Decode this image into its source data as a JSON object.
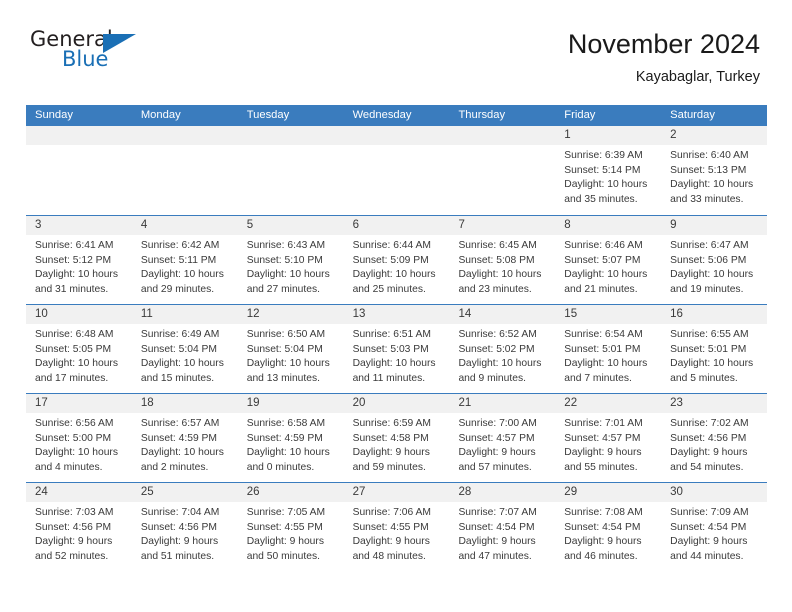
{
  "logo": {
    "word_one": "General",
    "word_two": "Blue",
    "triangle_icon": "blue-triangle-icon",
    "brand_color": "#1a6fb5"
  },
  "header": {
    "title": "November 2024",
    "subtitle": "Kayabaglar, Turkey"
  },
  "calendar": {
    "header_color": "#3a7cbe",
    "day_band_color": "#f1f1f1",
    "weekdays": [
      "Sunday",
      "Monday",
      "Tuesday",
      "Wednesday",
      "Thursday",
      "Friday",
      "Saturday"
    ],
    "weeks": [
      [
        {
          "empty": true
        },
        {
          "empty": true
        },
        {
          "empty": true
        },
        {
          "empty": true
        },
        {
          "empty": true
        },
        {
          "day": "1",
          "sunrise": "Sunrise: 6:39 AM",
          "sunset": "Sunset: 5:14 PM",
          "daylight_1": "Daylight: 10 hours",
          "daylight_2": "and 35 minutes."
        },
        {
          "day": "2",
          "sunrise": "Sunrise: 6:40 AM",
          "sunset": "Sunset: 5:13 PM",
          "daylight_1": "Daylight: 10 hours",
          "daylight_2": "and 33 minutes."
        }
      ],
      [
        {
          "day": "3",
          "sunrise": "Sunrise: 6:41 AM",
          "sunset": "Sunset: 5:12 PM",
          "daylight_1": "Daylight: 10 hours",
          "daylight_2": "and 31 minutes."
        },
        {
          "day": "4",
          "sunrise": "Sunrise: 6:42 AM",
          "sunset": "Sunset: 5:11 PM",
          "daylight_1": "Daylight: 10 hours",
          "daylight_2": "and 29 minutes."
        },
        {
          "day": "5",
          "sunrise": "Sunrise: 6:43 AM",
          "sunset": "Sunset: 5:10 PM",
          "daylight_1": "Daylight: 10 hours",
          "daylight_2": "and 27 minutes."
        },
        {
          "day": "6",
          "sunrise": "Sunrise: 6:44 AM",
          "sunset": "Sunset: 5:09 PM",
          "daylight_1": "Daylight: 10 hours",
          "daylight_2": "and 25 minutes."
        },
        {
          "day": "7",
          "sunrise": "Sunrise: 6:45 AM",
          "sunset": "Sunset: 5:08 PM",
          "daylight_1": "Daylight: 10 hours",
          "daylight_2": "and 23 minutes."
        },
        {
          "day": "8",
          "sunrise": "Sunrise: 6:46 AM",
          "sunset": "Sunset: 5:07 PM",
          "daylight_1": "Daylight: 10 hours",
          "daylight_2": "and 21 minutes."
        },
        {
          "day": "9",
          "sunrise": "Sunrise: 6:47 AM",
          "sunset": "Sunset: 5:06 PM",
          "daylight_1": "Daylight: 10 hours",
          "daylight_2": "and 19 minutes."
        }
      ],
      [
        {
          "day": "10",
          "sunrise": "Sunrise: 6:48 AM",
          "sunset": "Sunset: 5:05 PM",
          "daylight_1": "Daylight: 10 hours",
          "daylight_2": "and 17 minutes."
        },
        {
          "day": "11",
          "sunrise": "Sunrise: 6:49 AM",
          "sunset": "Sunset: 5:04 PM",
          "daylight_1": "Daylight: 10 hours",
          "daylight_2": "and 15 minutes."
        },
        {
          "day": "12",
          "sunrise": "Sunrise: 6:50 AM",
          "sunset": "Sunset: 5:04 PM",
          "daylight_1": "Daylight: 10 hours",
          "daylight_2": "and 13 minutes."
        },
        {
          "day": "13",
          "sunrise": "Sunrise: 6:51 AM",
          "sunset": "Sunset: 5:03 PM",
          "daylight_1": "Daylight: 10 hours",
          "daylight_2": "and 11 minutes."
        },
        {
          "day": "14",
          "sunrise": "Sunrise: 6:52 AM",
          "sunset": "Sunset: 5:02 PM",
          "daylight_1": "Daylight: 10 hours",
          "daylight_2": "and 9 minutes."
        },
        {
          "day": "15",
          "sunrise": "Sunrise: 6:54 AM",
          "sunset": "Sunset: 5:01 PM",
          "daylight_1": "Daylight: 10 hours",
          "daylight_2": "and 7 minutes."
        },
        {
          "day": "16",
          "sunrise": "Sunrise: 6:55 AM",
          "sunset": "Sunset: 5:01 PM",
          "daylight_1": "Daylight: 10 hours",
          "daylight_2": "and 5 minutes."
        }
      ],
      [
        {
          "day": "17",
          "sunrise": "Sunrise: 6:56 AM",
          "sunset": "Sunset: 5:00 PM",
          "daylight_1": "Daylight: 10 hours",
          "daylight_2": "and 4 minutes."
        },
        {
          "day": "18",
          "sunrise": "Sunrise: 6:57 AM",
          "sunset": "Sunset: 4:59 PM",
          "daylight_1": "Daylight: 10 hours",
          "daylight_2": "and 2 minutes."
        },
        {
          "day": "19",
          "sunrise": "Sunrise: 6:58 AM",
          "sunset": "Sunset: 4:59 PM",
          "daylight_1": "Daylight: 10 hours",
          "daylight_2": "and 0 minutes."
        },
        {
          "day": "20",
          "sunrise": "Sunrise: 6:59 AM",
          "sunset": "Sunset: 4:58 PM",
          "daylight_1": "Daylight: 9 hours",
          "daylight_2": "and 59 minutes."
        },
        {
          "day": "21",
          "sunrise": "Sunrise: 7:00 AM",
          "sunset": "Sunset: 4:57 PM",
          "daylight_1": "Daylight: 9 hours",
          "daylight_2": "and 57 minutes."
        },
        {
          "day": "22",
          "sunrise": "Sunrise: 7:01 AM",
          "sunset": "Sunset: 4:57 PM",
          "daylight_1": "Daylight: 9 hours",
          "daylight_2": "and 55 minutes."
        },
        {
          "day": "23",
          "sunrise": "Sunrise: 7:02 AM",
          "sunset": "Sunset: 4:56 PM",
          "daylight_1": "Daylight: 9 hours",
          "daylight_2": "and 54 minutes."
        }
      ],
      [
        {
          "day": "24",
          "sunrise": "Sunrise: 7:03 AM",
          "sunset": "Sunset: 4:56 PM",
          "daylight_1": "Daylight: 9 hours",
          "daylight_2": "and 52 minutes."
        },
        {
          "day": "25",
          "sunrise": "Sunrise: 7:04 AM",
          "sunset": "Sunset: 4:56 PM",
          "daylight_1": "Daylight: 9 hours",
          "daylight_2": "and 51 minutes."
        },
        {
          "day": "26",
          "sunrise": "Sunrise: 7:05 AM",
          "sunset": "Sunset: 4:55 PM",
          "daylight_1": "Daylight: 9 hours",
          "daylight_2": "and 50 minutes."
        },
        {
          "day": "27",
          "sunrise": "Sunrise: 7:06 AM",
          "sunset": "Sunset: 4:55 PM",
          "daylight_1": "Daylight: 9 hours",
          "daylight_2": "and 48 minutes."
        },
        {
          "day": "28",
          "sunrise": "Sunrise: 7:07 AM",
          "sunset": "Sunset: 4:54 PM",
          "daylight_1": "Daylight: 9 hours",
          "daylight_2": "and 47 minutes."
        },
        {
          "day": "29",
          "sunrise": "Sunrise: 7:08 AM",
          "sunset": "Sunset: 4:54 PM",
          "daylight_1": "Daylight: 9 hours",
          "daylight_2": "and 46 minutes."
        },
        {
          "day": "30",
          "sunrise": "Sunrise: 7:09 AM",
          "sunset": "Sunset: 4:54 PM",
          "daylight_1": "Daylight: 9 hours",
          "daylight_2": "and 44 minutes."
        }
      ]
    ]
  }
}
